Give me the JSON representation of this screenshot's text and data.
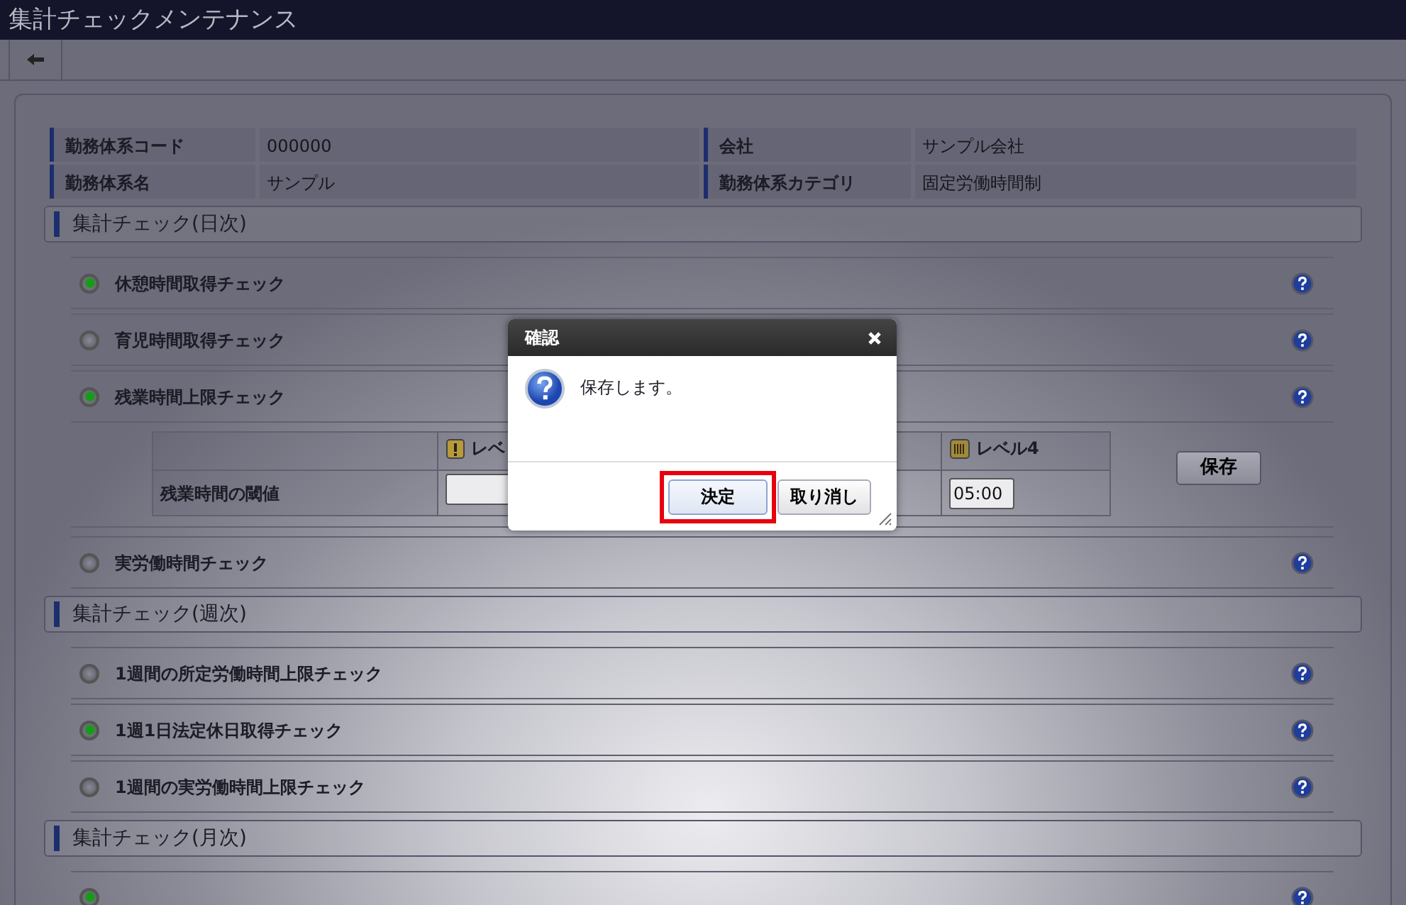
{
  "window": {
    "title": "集計チェックメンテナンス"
  },
  "info": [
    {
      "label": "勤務体系コード",
      "value": "000000"
    },
    {
      "label": "会社",
      "value": "サンプル会社"
    },
    {
      "label": "勤務体系名",
      "value": "サンプル"
    },
    {
      "label": "勤務体系カテゴリ",
      "value": "固定労働時間制"
    }
  ],
  "sections": [
    {
      "title": "集計チェック(日次)",
      "checks": [
        {
          "label": "休憩時間取得チェック",
          "on": true
        },
        {
          "label": "育児時間取得チェック",
          "on": false
        },
        {
          "label": "残業時間上限チェック",
          "on": true,
          "threshold": {
            "row_label": "残業時間の閾値",
            "levels": [
              {
                "kind": "warning",
                "label": "レベ"
              },
              {
                "kind": "meter",
                "label": "レベル4",
                "value": "05:00"
              }
            ],
            "save_button": "保存"
          }
        },
        {
          "label": "実労働時間チェック",
          "on": false
        }
      ]
    },
    {
      "title": "集計チェック(週次)",
      "checks": [
        {
          "label": "1週間の所定労働時間上限チェック",
          "on": false
        },
        {
          "label": "1週1日法定休日取得チェック",
          "on": true
        },
        {
          "label": "1週間の実労働時間上限チェック",
          "on": false
        }
      ]
    },
    {
      "title": "集計チェック(月次)",
      "checks": [
        {
          "on": true
        }
      ]
    }
  ],
  "dialog": {
    "title": "確認",
    "message": "保存します。",
    "buttons": [
      {
        "label": "決定",
        "highlighted": true
      },
      {
        "label": "取り消し",
        "highlighted": false
      }
    ]
  }
}
